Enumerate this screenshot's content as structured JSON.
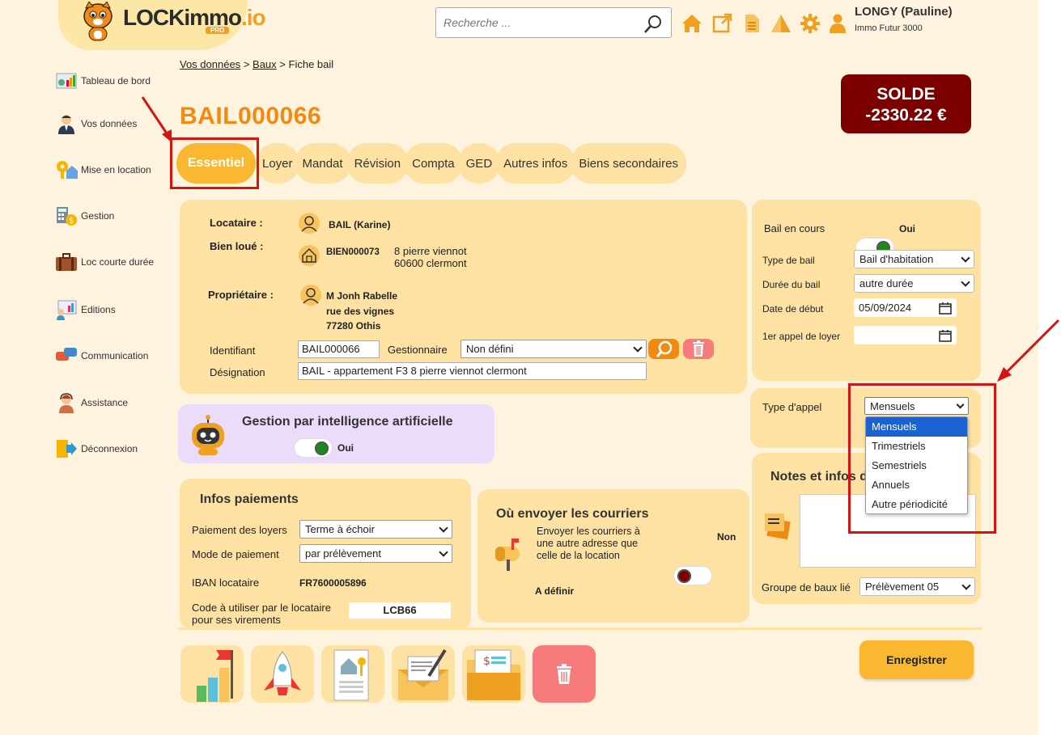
{
  "header": {
    "logo_text": "LOCKimmo",
    "logo_suffix": ".io",
    "logo_badge": "PRO",
    "search_placeholder": "Recherche ...",
    "user_name": "LONGY (Pauline)",
    "user_company": "Immo Futur 3000",
    "icons": [
      "home-icon",
      "external-link-icon",
      "document-icon",
      "warning-icon",
      "gear-icon",
      "user-icon"
    ]
  },
  "sidebar": {
    "items": [
      {
        "label": "Tableau de bord",
        "icon": "dashboard-icon"
      },
      {
        "label": "Vos données",
        "icon": "person-icon"
      },
      {
        "label": "Mise en location",
        "icon": "key-house-icon"
      },
      {
        "label": "Gestion",
        "icon": "calculator-icon"
      },
      {
        "label": "Loc courte durée",
        "icon": "suitcase-icon"
      },
      {
        "label": "Editions",
        "icon": "presentation-icon"
      },
      {
        "label": "Communication",
        "icon": "chat-icon"
      },
      {
        "label": "Assistance",
        "icon": "support-icon"
      },
      {
        "label": "Déconnexion",
        "icon": "logout-icon"
      }
    ]
  },
  "breadcrumb": {
    "part1": "Vos données",
    "sep1": ">",
    "part2": "Baux",
    "sep2": ">",
    "current": "Fiche bail"
  },
  "solde": {
    "label": "SOLDE",
    "value": "-2330.22 €"
  },
  "title": "BAIL000066",
  "tabs": [
    "Essentiel",
    "Loyer",
    "Mandat",
    "Révision",
    "Compta",
    "GED",
    "Autres infos",
    "Biens secondaires"
  ],
  "main_card": {
    "locataire_label": "Locataire :",
    "locataire_value": "BAIL (Karine)",
    "bien_label": "Bien loué :",
    "bien_code": "BIEN000073",
    "bien_addr1": "8 pierre viennot",
    "bien_addr2": "60600 clermont",
    "proprietaire_label": "Propriétaire :",
    "proprietaire_name": "M Jonh Rabelle",
    "proprietaire_addr1": "rue des vignes",
    "proprietaire_addr2": "77280 Othis",
    "identifiant_label": "Identifiant",
    "identifiant_value": "BAIL000066",
    "gestionnaire_label": "Gestionnaire",
    "gestionnaire_value": "Non défini",
    "designation_label": "Désignation",
    "designation_value": "BAIL - appartement F3 8 pierre viennot clermont"
  },
  "ai_card": {
    "title": "Gestion par intelligence artificielle",
    "toggle_label": "Oui"
  },
  "bail_card": {
    "bail_en_cours_label": "Bail en cours",
    "bail_en_cours_value": "Oui",
    "type_bail_label": "Type de bail",
    "type_bail_value": "Bail d'habitation",
    "duree_label": "Durée du bail",
    "duree_value": "autre durée",
    "date_debut_label": "Date de début",
    "date_debut_value": "05/09/2024",
    "appel_label": "1er appel de loyer",
    "appel_value": ""
  },
  "appel_card": {
    "label": "Type d'appel",
    "value": "Mensuels",
    "options": [
      "Mensuels",
      "Trimestriels",
      "Semestriels",
      "Annuels",
      "Autre périodicité"
    ]
  },
  "notes_card": {
    "title": "Notes et infos d",
    "groupe_label": "Groupe de baux lié",
    "groupe_value": "Prélèvement 05"
  },
  "paiements": {
    "title": "Infos paiements",
    "paiement_label": "Paiement des loyers",
    "paiement_value": "Terme à échoir",
    "mode_label": "Mode de paiement",
    "mode_value": "par prélèvement",
    "iban_label": "IBAN locataire",
    "iban_value": "FR7600005896",
    "code_label1": "Code à utiliser par le locataire",
    "code_label2": "pour ses virements",
    "code_value": "LCB66"
  },
  "courriers": {
    "title": "Où envoyer les courriers",
    "text1": "Envoyer les courriers à",
    "text2": "une autre adresse que",
    "text3": "celle de la location",
    "toggle_label": "Non",
    "adresse": "A définir"
  },
  "actions": {
    "save_label": "Enregistrer"
  },
  "colors": {
    "accent": "#f9b830",
    "title": "#f28a12",
    "solde_bg": "#7d0000",
    "card": "#fde2a4",
    "page": "#fdf3de",
    "annotation": "#d51313"
  }
}
